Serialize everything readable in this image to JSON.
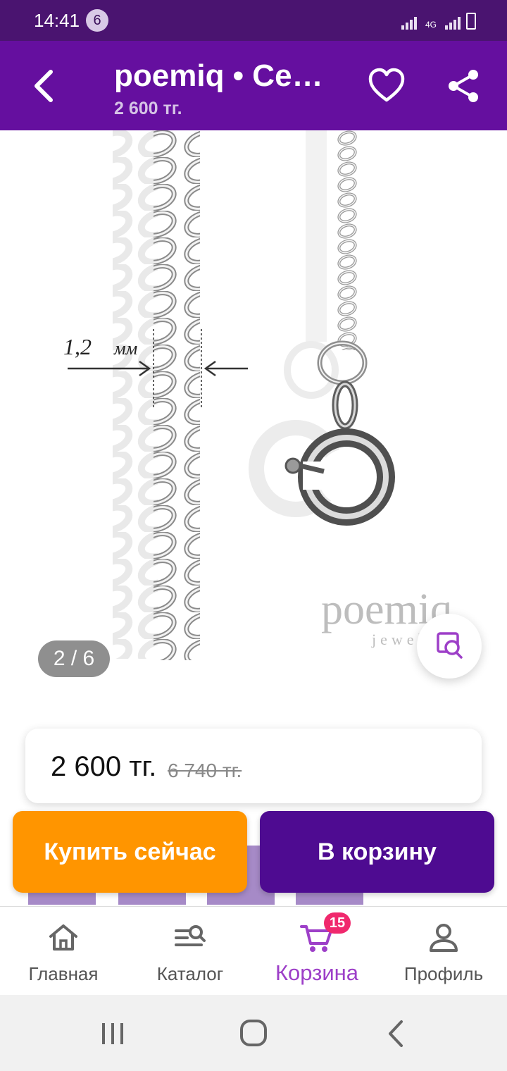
{
  "status": {
    "time": "14:41",
    "notification_count": "6",
    "network": "4G"
  },
  "header": {
    "title": "poemiq • Серебряная цепочка",
    "subtitle": "2 600 тг."
  },
  "gallery": {
    "counter": "2 / 6",
    "measure_value": "1,2",
    "measure_unit": "мм",
    "brand_watermark": "poemiq",
    "brand_sub": "jewel"
  },
  "price": {
    "current": "2 600 тг.",
    "old": "6 740 тг."
  },
  "actions": {
    "buy_now": "Купить сейчас",
    "add_to_cart": "В корзину"
  },
  "bottom_nav": {
    "items": [
      {
        "label": "Главная",
        "icon": "home-icon"
      },
      {
        "label": "Каталог",
        "icon": "catalog-icon"
      },
      {
        "label": "Корзина",
        "icon": "cart-icon",
        "badge": "15",
        "active": true
      },
      {
        "label": "Профиль",
        "icon": "profile-icon"
      }
    ]
  },
  "colors": {
    "header_bg": "#650f9f",
    "buy_button": "#ff9500",
    "cart_button": "#4e0b91",
    "active_nav": "#9d3fc8",
    "badge": "#f0286d"
  }
}
